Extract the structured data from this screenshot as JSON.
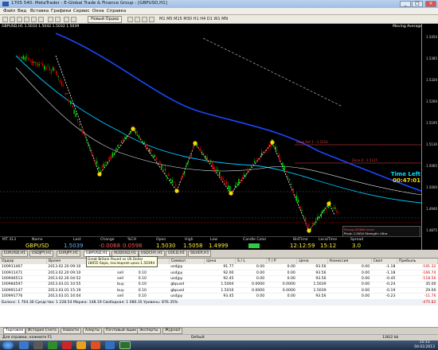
{
  "window": {
    "title": "1705 540: MetaTrader - E-Global Trade & Finance Group - [GBPUSD,H1]",
    "min": "_",
    "max": "□",
    "close": "×"
  },
  "menu": [
    "Файл",
    "Вид",
    "Вставка",
    "Графики",
    "Сервис",
    "Окна",
    "Справка"
  ],
  "toolbar": {
    "new_order": "Новый Ордер",
    "timeframes": "M1 M5 M15 M30 H1 H4 D1 W1 MN"
  },
  "chart": {
    "header": "GBPUSD,H1  1.5033 1.5042 1.5032 1.5039",
    "indicator": "Moving Average",
    "price_ticks": [
      "1.5450",
      "1.5385",
      "1.5320",
      "1.5260",
      "1.5195",
      "1.5130",
      "1.5065",
      "1.5000",
      "1.4940",
      "1.4875"
    ],
    "date_ticks": [
      "18 Feb 2013",
      "19 Feb 02:00",
      "19 Feb 18:00",
      "20 Feb 10:00",
      "21 Feb 02:00",
      "21 Feb 18:00",
      "22 Feb 10:00",
      "25 Feb 02:00",
      "25 Feb 18:00",
      "26 Feb 10:00",
      "27 Feb 02:00",
      "27 Feb 18:00",
      "28 Feb 10:00",
      "1 Mar 02:00",
      "1 Mar 18:00",
      "4 Mar 10:00"
    ],
    "time_left_label": "Time Left",
    "time_left": "00:47:01",
    "levels": [
      {
        "label": "Zone Ext 1 - 1.5214",
        "price": "1.5214"
      },
      {
        "label": "Zone 0 - 1.5135",
        "price": "1.5135"
      }
    ],
    "legend": [
      "Strong DOWN trend",
      "Pivot: 1.5054  Strength: Ultra"
    ],
    "strip": {
      "headers": [
        "MT 313",
        "Name",
        "Last",
        "Change",
        "%CH",
        "Open",
        "High",
        "Low",
        "Candle Color",
        "BidTime",
        "LocalTime",
        "Spread"
      ],
      "values": [
        "GBPUSD",
        "1.5039",
        "-0.0068",
        "0.0598",
        "1.5030",
        "1.5058",
        "1.4999",
        "",
        "12:12:59",
        "15:12",
        "3.0"
      ]
    }
  },
  "chart_tabs": [
    "EURUSD,H1",
    "USDJPY,H1",
    "EURJPY,H1",
    "GBPUSD,H1",
    "AUDUSD,H1",
    "USDCHF,H1",
    "GOLD,H1",
    "SILVER,H1"
  ],
  "tooltip": [
    "Great Britain Pound vs US Dollar",
    "18055 бара, последняя цена 1.50394"
  ],
  "terminal": {
    "columns": [
      "Ордер",
      "Время",
      "Тип",
      "Объём",
      "Символ",
      "Цена",
      "S / L",
      "T / P",
      "Цена",
      "Комиссия",
      "Своп",
      "Прибыль"
    ],
    "rows": [
      [
        "100911467",
        "2013.02.20 09:10",
        "sell",
        "0.10",
        "usdjpy",
        "91.77",
        "0.00",
        "0.00",
        "93.56",
        "0.00",
        "-1.18",
        "-191.32"
      ],
      [
        "100911471",
        "2013.02.20 09:10",
        "sell",
        "0.10",
        "usdjpy",
        "92.00",
        "0.00",
        "0.00",
        "93.56",
        "0.00",
        "-1.18",
        "-166.74"
      ],
      [
        "100946513",
        "2013.02.26 04:52",
        "sell",
        "0.10",
        "usdjpy",
        "92.45",
        "0.00",
        "0.00",
        "93.56",
        "0.00",
        "-0.45",
        "-118.56"
      ],
      [
        "100984597",
        "2013.03.01 10:55",
        "buy",
        "0.10",
        "gbpusd",
        "1.5004",
        "0.0000",
        "0.0000",
        "1.5039",
        "0.00",
        "-0.24",
        "35.00"
      ],
      [
        "100991147",
        "2013.03.01 15:19",
        "buy",
        "0.10",
        "gbpusd",
        "1.5010",
        "0.0000",
        "0.0000",
        "1.5039",
        "0.00",
        "-0.19",
        "29.00"
      ],
      [
        "100991776",
        "2013.03.01 16:04",
        "sell",
        "0.10",
        "usdjpy",
        "93.45",
        "0.00",
        "0.00",
        "93.56",
        "0.00",
        "-0.23",
        "-11.76"
      ]
    ],
    "balance": "Баланс: 1 704.36  Средства: 1 228.54  Маржа: 148.19  Свободная: 1 080.35  Уровень: 876.35%",
    "balance_total": "-475.82",
    "tabs": [
      "Торговля",
      "История Счета",
      "Новости",
      "Алерты",
      "Почтовый ящик",
      "Эксперты",
      "Журнал"
    ]
  },
  "status": {
    "help": "Для справки, нажмите F1",
    "profile": "Default",
    "traffic": "136/2 kb"
  },
  "clock": {
    "time": "15:13",
    "date": "04.03.2013"
  }
}
